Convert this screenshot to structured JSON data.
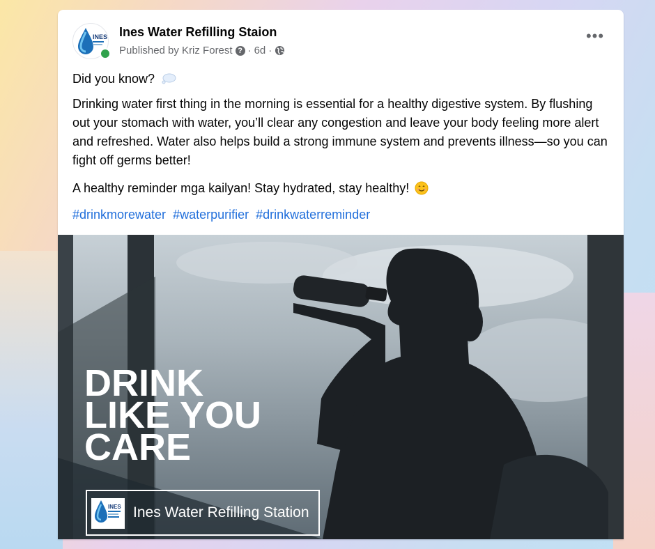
{
  "post": {
    "page_name": "Ines Water Refilling Staion",
    "published_by": "Published by Kriz Forest",
    "time": "6d",
    "separator": "·",
    "more_label": "•••",
    "intro": "Did you know?",
    "body": "Drinking water first thing in the morning is essential for a healthy digestive system. By flushing out your stomach with water, you’ll clear any congestion and leave your body feeling more alert and refreshed. Water also helps build a strong immune system and prevents illness—so you can fight off germs better!",
    "reminder": "A healthy reminder mga kailyan! Stay hydrated, stay healthy!",
    "hashtags": [
      "#drinkmorewater",
      "#waterpurifier",
      "#drinkwaterreminder"
    ],
    "avatar_logo_text": "INES"
  },
  "image": {
    "headline": [
      "DRINK",
      "LIKE YOU",
      "CARE"
    ],
    "brand": "Ines Water Refilling Station",
    "brand_logo_text": "INES"
  },
  "colors": {
    "hashtag": "#216fdb",
    "online": "#31a24c"
  },
  "icons": [
    "question-icon",
    "globe-icon",
    "thought-bubble-icon",
    "smiling-face-icon",
    "water-drop-logo",
    "more-options-icon"
  ]
}
